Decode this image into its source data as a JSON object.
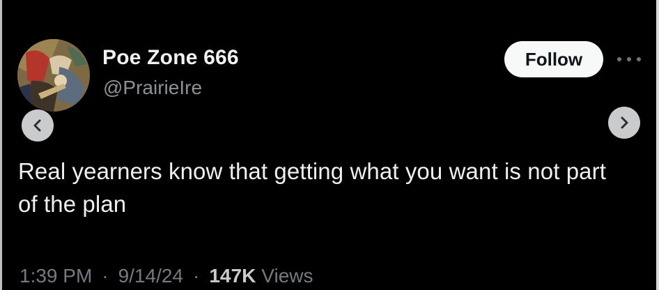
{
  "author": {
    "display_name": "Poe Zone 666",
    "handle": "@PrairieIre"
  },
  "actions": {
    "follow_label": "Follow"
  },
  "tweet": {
    "text": "Real yearners know that getting what you want is not part of the plan"
  },
  "meta": {
    "time": "1:39 PM",
    "date": "9/14/24",
    "views_count": "147K",
    "views_label": "Views",
    "separator": "·"
  },
  "icons": {
    "avatar": "avatar-image",
    "more": "more-options-icon",
    "prev": "chevron-left-icon",
    "next": "chevron-right-icon"
  },
  "colors": {
    "background": "#000000",
    "text_primary": "#eef0f1",
    "text_secondary": "#8b9196",
    "follow_bg": "#f7f9f9",
    "nav_button_bg": "#c9cbcc"
  }
}
